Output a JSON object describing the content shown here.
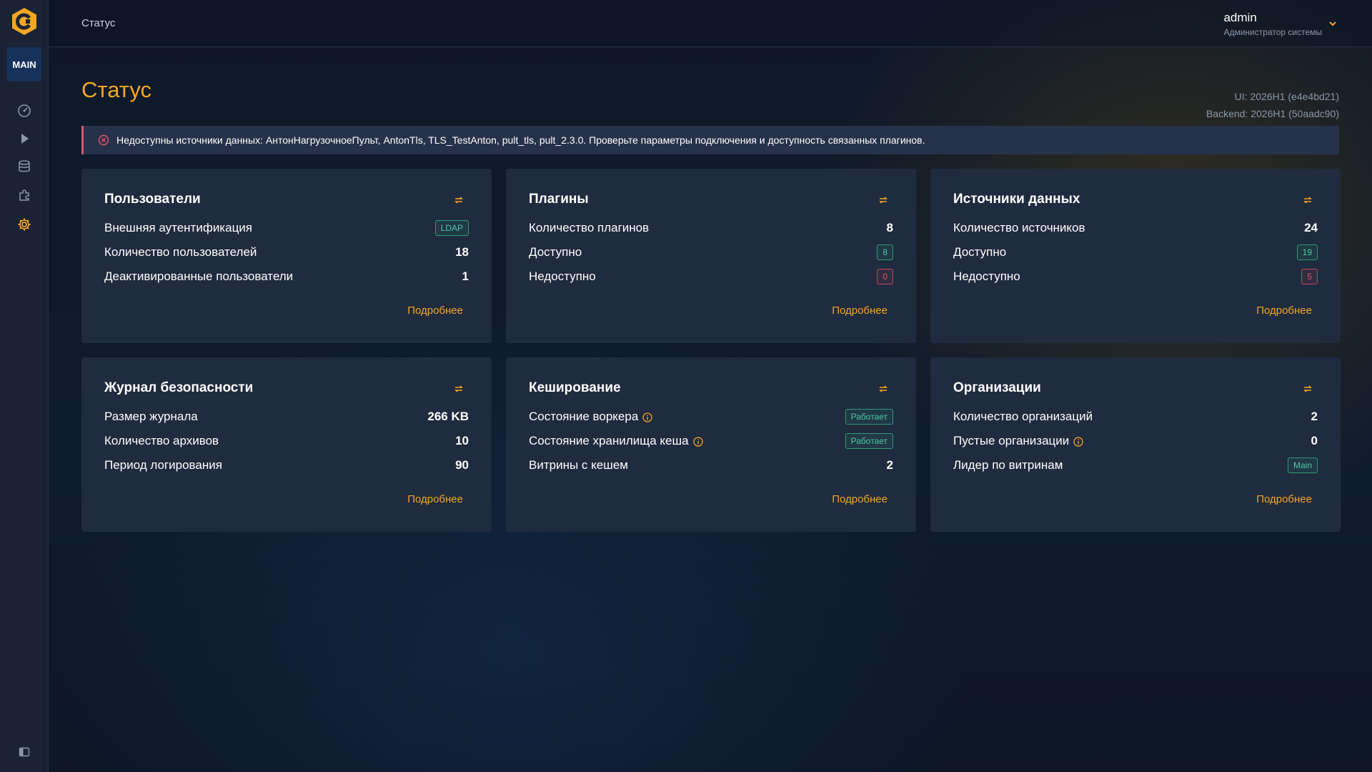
{
  "colors": {
    "accent": "#f5a623",
    "success": "#4cc9a0",
    "danger": "#e0566b",
    "card": "#1f2b3e"
  },
  "sidebar": {
    "badge": "MAIN",
    "icons": [
      "dashboard-icon",
      "play-icon",
      "database-icon",
      "puzzle-icon",
      "settings-icon"
    ],
    "active": "settings-icon"
  },
  "topbar": {
    "breadcrumb": "Статус",
    "user": {
      "name": "admin",
      "role": "Администратор системы"
    }
  },
  "page": {
    "title": "Статус",
    "version_ui": "UI: 2026H1 (e4e4bd21)",
    "version_backend": "Backend: 2026H1 (50aadc90)"
  },
  "alert": {
    "text": "Недоступны источники данных: АнтонНагрузочноеПульт, AntonTls, TLS_TestAnton, pult_tls, pult_2.3.0. Проверьте параметры подключения и доступность связанных плагинов."
  },
  "cards": [
    {
      "title": "Пользователи",
      "more": "Подробнее",
      "rows": [
        {
          "label": "Внешняя аутентификация",
          "value": "LDAP",
          "kind": "badge-green",
          "info": false
        },
        {
          "label": "Количество пользователей",
          "value": "18",
          "kind": "text",
          "info": false
        },
        {
          "label": "Деактивированные пользователи",
          "value": "1",
          "kind": "text",
          "info": false
        }
      ]
    },
    {
      "title": "Плагины",
      "more": "Подробнее",
      "rows": [
        {
          "label": "Количество плагинов",
          "value": "8",
          "kind": "text",
          "info": false
        },
        {
          "label": "Доступно",
          "value": "8",
          "kind": "badge-green",
          "info": false
        },
        {
          "label": "Недоступно",
          "value": "0",
          "kind": "badge-red",
          "info": false
        }
      ]
    },
    {
      "title": "Источники данных",
      "more": "Подробнее",
      "rows": [
        {
          "label": "Количество источников",
          "value": "24",
          "kind": "text",
          "info": false
        },
        {
          "label": "Доступно",
          "value": "19",
          "kind": "badge-green",
          "info": false
        },
        {
          "label": "Недоступно",
          "value": "5",
          "kind": "badge-red",
          "info": false
        }
      ]
    },
    {
      "title": "Журнал безопасности",
      "more": "Подробнее",
      "rows": [
        {
          "label": "Размер журнала",
          "value": "266 KB",
          "kind": "text",
          "info": false
        },
        {
          "label": "Количество архивов",
          "value": "10",
          "kind": "text",
          "info": false
        },
        {
          "label": "Период логирования",
          "value": "90",
          "kind": "text",
          "info": false
        }
      ]
    },
    {
      "title": "Кеширование",
      "more": "Подробнее",
      "rows": [
        {
          "label": "Состояние воркера",
          "value": "Работает",
          "kind": "badge-green",
          "info": true
        },
        {
          "label": "Состояние хранилища кеша",
          "value": "Работает",
          "kind": "badge-green",
          "info": true
        },
        {
          "label": "Витрины с кешем",
          "value": "2",
          "kind": "text",
          "info": false
        }
      ]
    },
    {
      "title": "Организации",
      "more": "Подробнее",
      "rows": [
        {
          "label": "Количество организаций",
          "value": "2",
          "kind": "text",
          "info": false
        },
        {
          "label": "Пустые организации",
          "value": "0",
          "kind": "text",
          "info": true
        },
        {
          "label": "Лидер по витринам",
          "value": "Main",
          "kind": "badge-green",
          "info": false
        }
      ]
    }
  ]
}
